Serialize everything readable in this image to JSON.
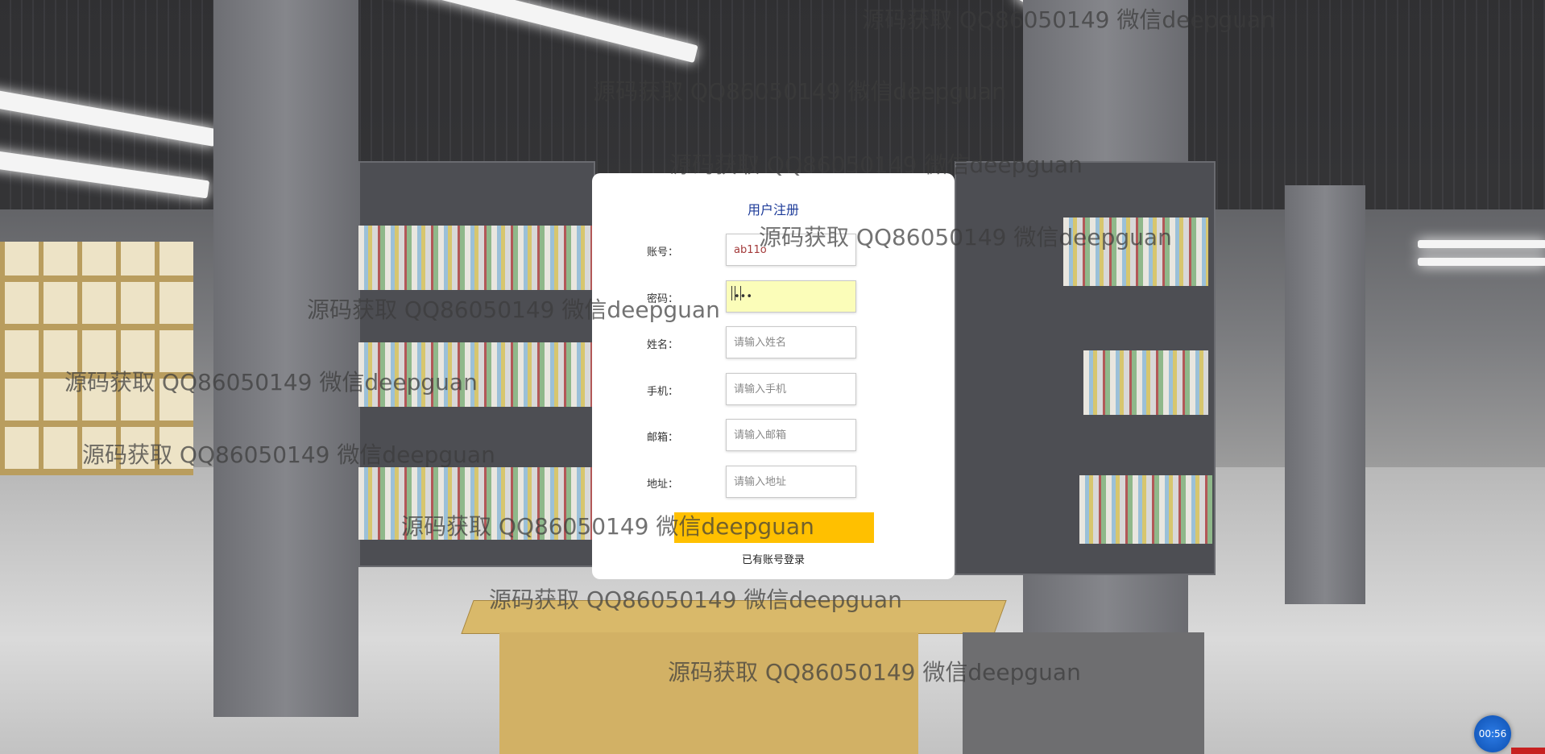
{
  "form": {
    "title": "用户注册",
    "fields": [
      {
        "label": "账号：",
        "value": "ab11o",
        "placeholder": ""
      },
      {
        "label": "密码：",
        "value": "•••",
        "placeholder": ""
      },
      {
        "label": "姓名：",
        "value": "",
        "placeholder": "请输入姓名"
      },
      {
        "label": "手机：",
        "value": "",
        "placeholder": "请输入手机"
      },
      {
        "label": "邮箱：",
        "value": "",
        "placeholder": "请输入邮箱"
      },
      {
        "label": "地址：",
        "value": "",
        "placeholder": "请输入地址"
      }
    ],
    "submit_label": "",
    "login_link": "已有账号登录"
  },
  "watermark_text": "源码获取 QQ86050149 微信deepguan",
  "timer": "00:56",
  "colors": {
    "title": "#1d3b99",
    "submit_button": "#ffc000",
    "password_field_bg": "#fbfdb9",
    "account_value": "#a33a3a"
  }
}
